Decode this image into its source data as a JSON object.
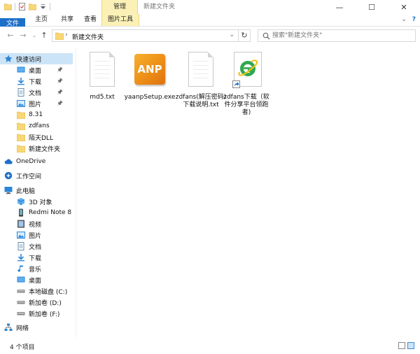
{
  "window": {
    "title": "新建文件夹",
    "context_tab": "管理",
    "controls": [
      "—",
      "☐",
      "✕"
    ]
  },
  "ribbon": {
    "tabs": [
      "文件",
      "主页",
      "共享",
      "查看",
      "图片工具"
    ],
    "expand": "⌄",
    "help": "?"
  },
  "address": {
    "path": "新建文件夹",
    "search_placeholder": "搜索\"新建文件夹\""
  },
  "sidebar": {
    "items": [
      {
        "label": "快速访问",
        "icon": "star-icon"
      },
      {
        "label": "桌面",
        "icon": "desktop-icon",
        "pinned": true
      },
      {
        "label": "下载",
        "icon": "download-icon",
        "pinned": true
      },
      {
        "label": "文档",
        "icon": "document-icon",
        "pinned": true
      },
      {
        "label": "图片",
        "icon": "picture-icon",
        "pinned": true
      },
      {
        "label": "8.31",
        "icon": "folder-icon"
      },
      {
        "label": "zdfans",
        "icon": "folder-icon"
      },
      {
        "label": "陌天DLL",
        "icon": "folder-icon"
      },
      {
        "label": "新建文件夹",
        "icon": "folder-icon"
      },
      {
        "label": "OneDrive",
        "icon": "cloud-icon"
      },
      {
        "label": "工作空间",
        "icon": "workspace-icon"
      },
      {
        "label": "此电脑",
        "icon": "computer-icon"
      },
      {
        "label": "3D 对象",
        "icon": "cube-icon"
      },
      {
        "label": "Redmi Note 8",
        "icon": "phone-icon"
      },
      {
        "label": "视频",
        "icon": "video-icon"
      },
      {
        "label": "图片",
        "icon": "picture-icon"
      },
      {
        "label": "文档",
        "icon": "document-icon"
      },
      {
        "label": "下载",
        "icon": "download-icon"
      },
      {
        "label": "音乐",
        "icon": "music-icon"
      },
      {
        "label": "桌面",
        "icon": "desktop-icon"
      },
      {
        "label": "本地磁盘 (C:)",
        "icon": "drive-icon"
      },
      {
        "label": "新加卷 (D:)",
        "icon": "drive-icon"
      },
      {
        "label": "新加卷 (F:)",
        "icon": "drive-icon"
      },
      {
        "label": "网络",
        "icon": "network-icon"
      }
    ]
  },
  "files": [
    {
      "name": "md5.txt",
      "icon": "text-file-icon"
    },
    {
      "name": "yaanpSetup.exe",
      "icon": "anp-app-icon",
      "badge": "ANP"
    },
    {
      "name": "zdfans(解压密码)下载说明.txt",
      "icon": "text-file-icon"
    },
    {
      "name": "zdfans下载（软件分享平台领跑者)",
      "icon": "ie-shortcut-icon"
    }
  ],
  "status": {
    "count": "4 个项目"
  },
  "colors": {
    "accent": "#1d6fc9",
    "context": "#fbf1b6",
    "selection": "#cce4f7",
    "folder": "#f8d775"
  }
}
